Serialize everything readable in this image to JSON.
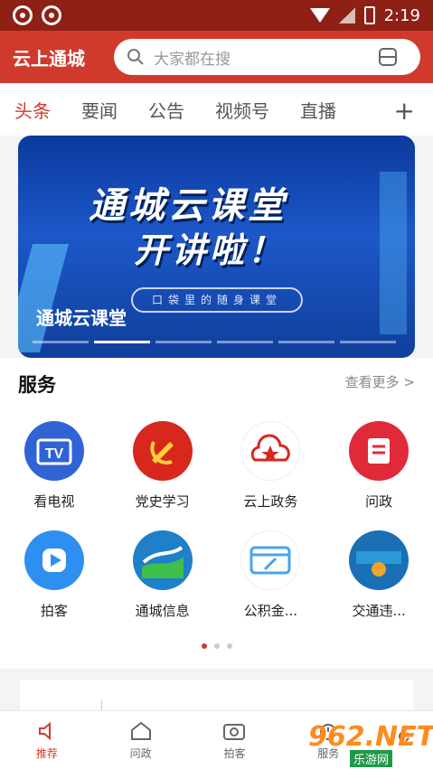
{
  "status_bar": {
    "time": "2:19"
  },
  "header": {
    "app_title": "云上通城",
    "search_placeholder": "大家都在搜"
  },
  "tabs": {
    "items": [
      "头条",
      "要闻",
      "公告",
      "视频号",
      "直播"
    ],
    "active_index": 0,
    "more_symbol": "+"
  },
  "banner": {
    "headline_1": "通城云课堂",
    "headline_2": "开讲啦！",
    "subtitle": "口袋里的随身课堂",
    "caption": "通城云课堂",
    "page_count": 6,
    "active_page": 1
  },
  "services": {
    "heading": "服务",
    "more_label": "查看更多 >",
    "items": [
      {
        "label": "看电视",
        "icon": "tv-icon",
        "color": "#2f63d6"
      },
      {
        "label": "党史学习",
        "icon": "party-emblem-icon",
        "color": "#d8271c"
      },
      {
        "label": "云上政务",
        "icon": "cloud-star-icon",
        "color": "#d8271c"
      },
      {
        "label": "问政",
        "icon": "document-icon",
        "color": "#e02a3a"
      },
      {
        "label": "拍客",
        "icon": "play-icon",
        "color": "#2f8ff0"
      },
      {
        "label": "通城信息",
        "icon": "landscape-icon",
        "color": "#1f7fc8"
      },
      {
        "label": "公积金...",
        "icon": "card-icon",
        "color": "#4aa3e8"
      },
      {
        "label": "交通违...",
        "icon": "traffic-violation-icon",
        "color": "#1a6fb5"
      }
    ],
    "pager": {
      "count": 3,
      "active": 0
    }
  },
  "bottom_nav": {
    "items": [
      {
        "label": "推荐",
        "icon": "speaker-icon"
      },
      {
        "label": "问政",
        "icon": "home-icon"
      },
      {
        "label": "拍客",
        "icon": "camera-icon"
      },
      {
        "label": "服务",
        "icon": "clock-icon"
      }
    ],
    "active_index": 0
  },
  "watermark": {
    "brand": "962.NET",
    "subtitle": "乐游网"
  },
  "colors": {
    "brand_red": "#cf3a2c",
    "status_bar": "#8e2015"
  }
}
